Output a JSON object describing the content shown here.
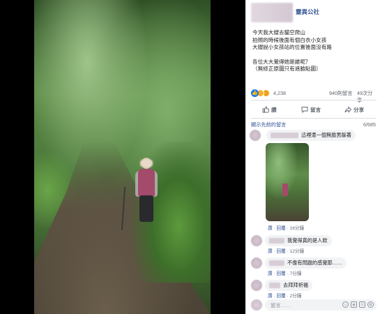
{
  "post": {
    "page_name": "靈異公社",
    "text_lines": [
      "今天我大嫂去貓空爬山",
      "拍照的時候後面有個白衣小女孩",
      "大嫂說小女孩站的位置後面沒有路",
      "",
      "各位大大覺得她是誰呢？",
      "（無修正原圖只有遮臉貼圖）"
    ],
    "reaction_count": "4,238",
    "comment_count": "940則留言",
    "share_count": "49次分享"
  },
  "actions": {
    "like": "讚",
    "comment": "留言",
    "share": "分享"
  },
  "comments_header": {
    "previous_label": "顯示先前的留言",
    "index": "6/685"
  },
  "comments": [
    {
      "text": "這裡遣一個無臉男躲著",
      "like": "讚",
      "reply": "回覆",
      "sep": "·",
      "time": ""
    },
    {
      "text": "",
      "like": "讚",
      "reply": "回覆",
      "sep": "·",
      "time": "16分鐘"
    },
    {
      "text": "我覺得真的是人欸",
      "like": "讚",
      "reply": "回覆",
      "sep": "·",
      "time": "12分鐘"
    },
    {
      "text": "不像有問題的感覺耶……",
      "like": "讚",
      "reply": "回覆",
      "sep": "·",
      "time": "7分鐘"
    },
    {
      "text": "去拜拜祈福",
      "like": "讚",
      "reply": "回覆",
      "sep": "·",
      "time": "2分鐘"
    }
  ],
  "composer": {
    "placeholder": "留言……",
    "icons": [
      "emoji-icon",
      "camera-icon",
      "gif-icon",
      "sticker-icon"
    ]
  },
  "colors": {
    "link": "#385898",
    "meta": "#606770",
    "bubble": "#f2f3f5",
    "like_blue": "#1877f2"
  }
}
